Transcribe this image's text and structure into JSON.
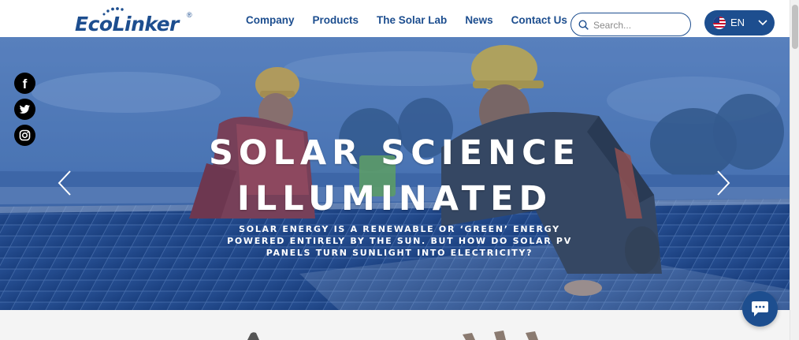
{
  "header": {
    "logo_text": "EcoLinker",
    "logo_mark": "®",
    "nav": [
      {
        "label": "Company"
      },
      {
        "label": "Products"
      },
      {
        "label": "The Solar Lab"
      },
      {
        "label": "News"
      },
      {
        "label": "Contact Us"
      }
    ],
    "search": {
      "placeholder": "Search...",
      "value": "",
      "icon": "search-icon"
    },
    "language": {
      "label": "EN",
      "flag": "us-flag-icon",
      "icon": "chevron-down-icon"
    }
  },
  "social": [
    {
      "name": "facebook-icon",
      "glyph": "f"
    },
    {
      "name": "twitter-icon",
      "glyph": ""
    },
    {
      "name": "instagram-icon",
      "glyph": ""
    }
  ],
  "hero": {
    "title_line1": "SOLAR SCIENCE",
    "title_line2": "ILLUMINATED",
    "subtitle": "SOLAR ENERGY IS A RENEWABLE OR ‘GREEN’ ENERGY POWERED ENTIRELY BY THE SUN. BUT HOW DO SOLAR PV PANELS TURN SUNLIGHT INTO ELECTRICITY?",
    "prev_icon": "chevron-left-icon",
    "next_icon": "chevron-right-icon"
  },
  "chat": {
    "icon": "chat-bubble-icon"
  },
  "colors": {
    "brand": "#1d4e8f",
    "hero_overlay": "#2f5ba0",
    "white": "#ffffff",
    "strip": "#f4f4f4"
  }
}
